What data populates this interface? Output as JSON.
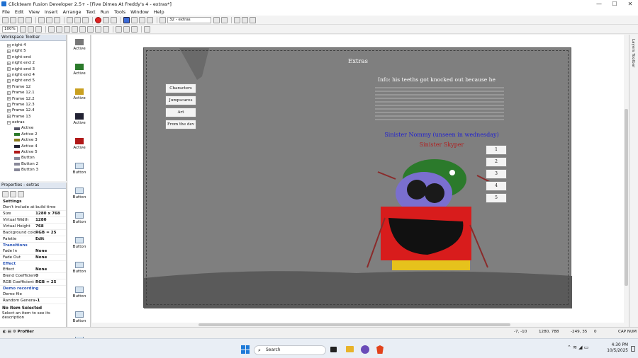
{
  "window": {
    "title": "Clickteam Fusion Developer 2.5+ - [Five Dimes At Freddy's 4 - extras*]",
    "controls": [
      "—",
      "☐",
      "✕"
    ]
  },
  "menu": [
    "File",
    "Edit",
    "View",
    "Insert",
    "Arrange",
    "Text",
    "Run",
    "Tools",
    "Window",
    "Help"
  ],
  "toolbar": {
    "frame_select": "32 - extras",
    "zoom": "100%"
  },
  "workspace": {
    "title": "Workspace Toolbar",
    "items": [
      {
        "label": "night 4",
        "type": "frame"
      },
      {
        "label": "night 5",
        "type": "frame"
      },
      {
        "label": "night end",
        "type": "frame"
      },
      {
        "label": "night end 2",
        "type": "frame"
      },
      {
        "label": "night end 3",
        "type": "frame"
      },
      {
        "label": "night end 4",
        "type": "frame"
      },
      {
        "label": "night end 5",
        "type": "frame"
      },
      {
        "label": "Frame 12",
        "type": "frame"
      },
      {
        "label": "Frame 12.1",
        "type": "frame"
      },
      {
        "label": "Frame 12.2",
        "type": "frame"
      },
      {
        "label": "Frame 12.3",
        "type": "frame"
      },
      {
        "label": "Frame 12.4",
        "type": "frame"
      },
      {
        "label": "Frame 13",
        "type": "frame"
      },
      {
        "label": "extras",
        "type": "frame-open"
      },
      {
        "label": "Active",
        "type": "object"
      },
      {
        "label": "Active 2",
        "type": "object"
      },
      {
        "label": "Active 3",
        "type": "object"
      },
      {
        "label": "Active 4",
        "type": "object"
      },
      {
        "label": "Active 5",
        "type": "object"
      },
      {
        "label": "Button",
        "type": "object"
      },
      {
        "label": "Button 2",
        "type": "object"
      },
      {
        "label": "Button 3",
        "type": "object"
      }
    ]
  },
  "properties": {
    "title": "Properties - extras",
    "settings_label": "Settings",
    "rows": [
      {
        "k": "Don't include at build time",
        "v": "",
        "check": true
      },
      {
        "k": "Size",
        "v": "1280 x 768"
      },
      {
        "k": "Virtual Width",
        "v": "1280"
      },
      {
        "k": "Virtual Height",
        "v": "768"
      },
      {
        "k": "Background color",
        "v": "RGB = 25"
      },
      {
        "k": "Palette",
        "v": "Edit"
      }
    ],
    "transitions_label": "Transitions",
    "transition_rows": [
      {
        "k": "Fade In",
        "v": "None"
      },
      {
        "k": "Fade Out",
        "v": "None"
      }
    ],
    "effect_label": "Effect",
    "effect_rows": [
      {
        "k": "Effect",
        "v": "None"
      },
      {
        "k": "Blend Coefficient",
        "v": "0"
      },
      {
        "k": "RGB Coefficient",
        "v": "RGB = 25"
      }
    ],
    "demo_label": "Demo recording",
    "demo_rows": [
      {
        "k": "Demo file",
        "v": ""
      },
      {
        "k": "Random Generator",
        "v": "-1"
      }
    ],
    "no_item": "No Item Selected",
    "hint": "Select an item to see its description"
  },
  "objects": [
    {
      "label": "Active"
    },
    {
      "label": "Active"
    },
    {
      "label": "Active"
    },
    {
      "label": "Active"
    },
    {
      "label": "Active"
    },
    {
      "label": "Button"
    },
    {
      "label": "Button"
    },
    {
      "label": "Button"
    },
    {
      "label": "Button"
    },
    {
      "label": "Button"
    },
    {
      "label": "Button"
    },
    {
      "label": "Button"
    },
    {
      "label": "Button"
    }
  ],
  "frame": {
    "title": "Extras",
    "menu_buttons": [
      "Characters",
      "Jumpscares",
      "Art",
      "From the dev"
    ],
    "number_buttons": [
      "1",
      "2",
      "3",
      "4",
      "5"
    ],
    "info_text": "Info: his teeths got knocked out because he",
    "character_name": "Sinister Nommy (unseen in wednesday)",
    "secondary_name": "Sinister Skyper"
  },
  "status": {
    "profiler": "Profiler",
    "coords": "-7, -10",
    "size": "1280, 788",
    "pos": "-249, 35",
    "count": "0",
    "caps": "CAP NUM"
  },
  "taskbar": {
    "search_placeholder": "Search",
    "time": "4:30 PM",
    "date": "10/5/2025"
  },
  "colors": {
    "frame_bg": "#7f7f7f",
    "title_name_color": "#1f1fd0",
    "skyper_color": "#b02020"
  }
}
